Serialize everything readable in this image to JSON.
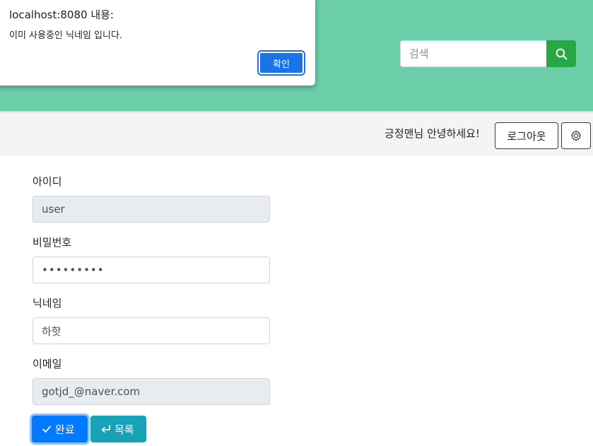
{
  "header": {
    "search_placeholder": "검색",
    "search_icon": "search-icon",
    "bg_color": "#6ccda9",
    "search_btn_color": "#28a745"
  },
  "subbar": {
    "greeting": "긍정맨님 안녕하세요!",
    "logout_label": "로그아웃",
    "settings_icon": "gear-icon"
  },
  "form": {
    "id_label": "아이디",
    "id_value": "user",
    "password_label": "비밀번호",
    "password_value": "password1",
    "nickname_label": "닉네임",
    "nickname_value": "하핫",
    "email_label": "이메일",
    "email_value": "gotjd_@naver.com"
  },
  "buttons": {
    "done_label": "완료",
    "done_icon": "check-icon",
    "list_label": "목록",
    "list_icon": "return-arrow-icon"
  },
  "dialog": {
    "title": "localhost:8080 내용:",
    "message": "이미 사용중인 닉네임 입니다.",
    "ok_label": "확인"
  }
}
